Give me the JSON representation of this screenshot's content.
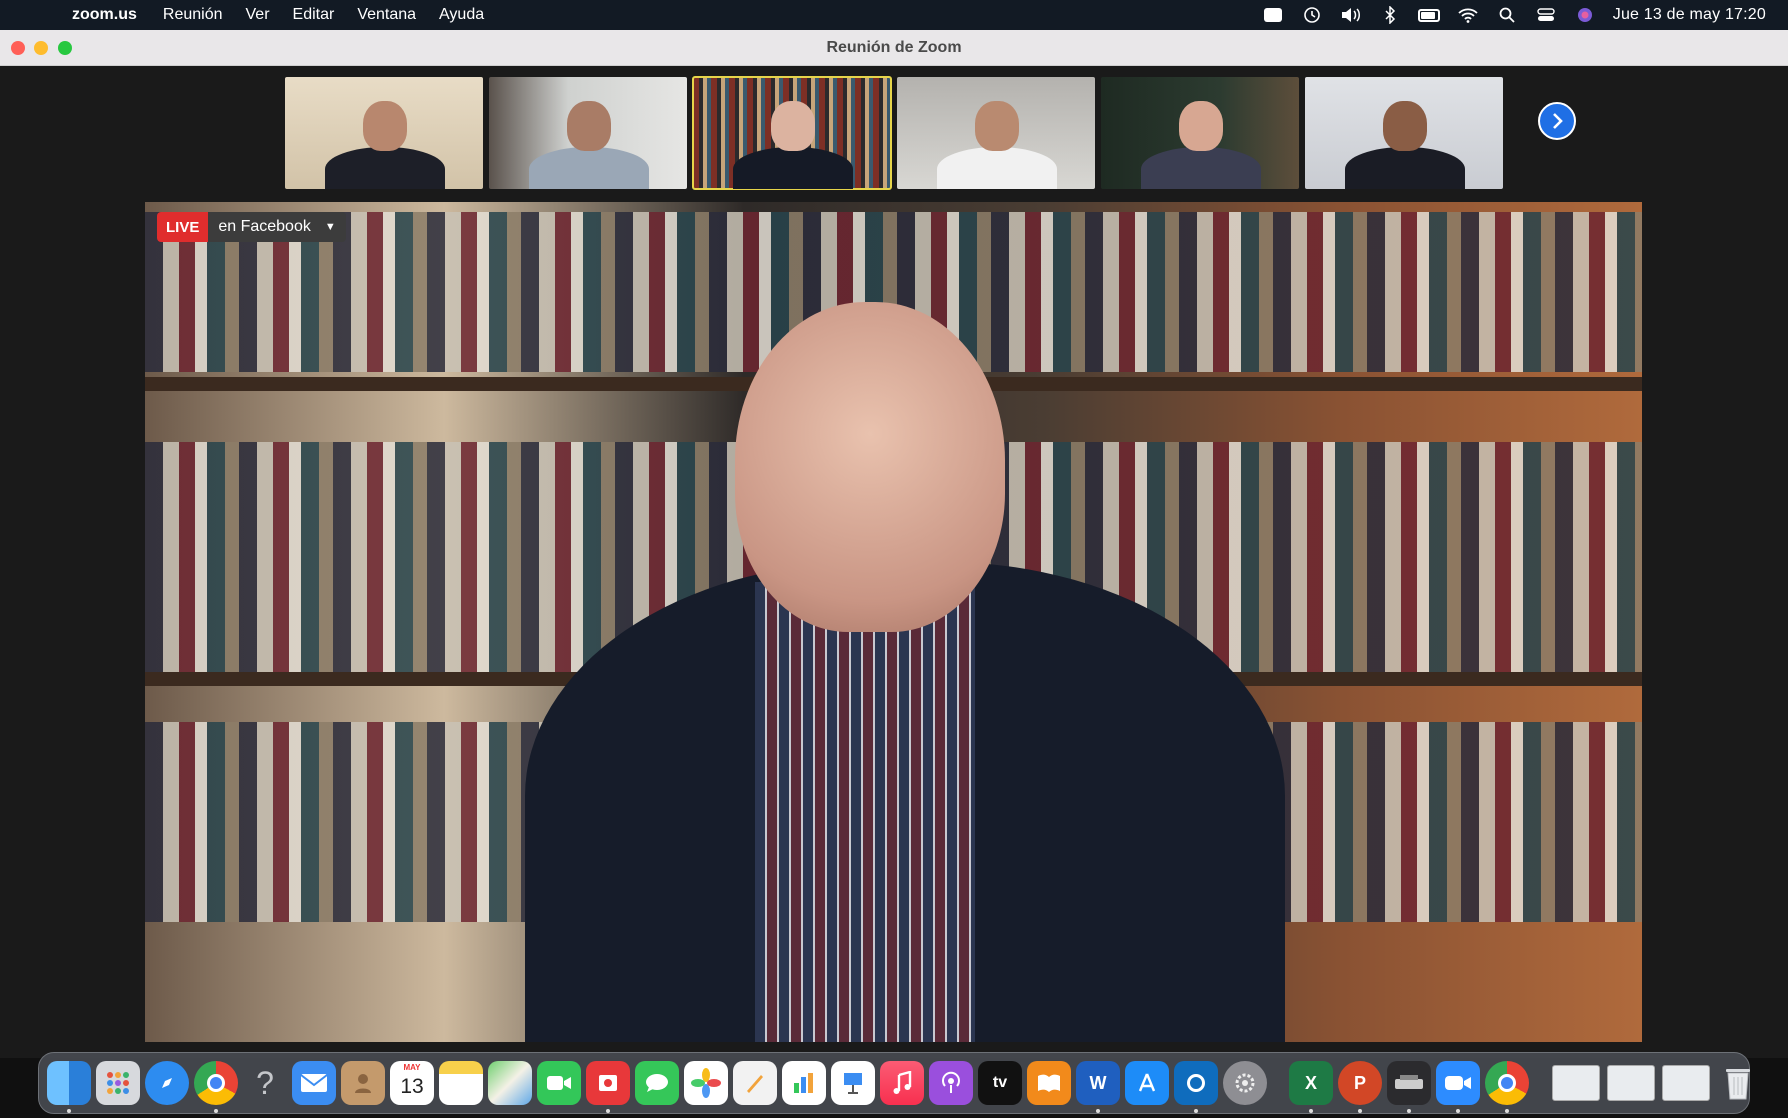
{
  "menubar": {
    "app_name": "zoom.us",
    "items": [
      "Reunión",
      "Ver",
      "Editar",
      "Ventana",
      "Ayuda"
    ],
    "clock": "Jue 13 de may  17:20"
  },
  "window": {
    "title": "Reunión de Zoom"
  },
  "live": {
    "tag": "LIVE",
    "label": "en Facebook"
  },
  "dock": {
    "calendar": {
      "month": "MAY",
      "day": "13"
    },
    "excel_letter": "X",
    "powerpoint_letter": "P",
    "word_letter": "W",
    "tv_label": "tv"
  },
  "colors": {
    "menubar_bg": "#121a24",
    "live_red": "#e02d2d",
    "active_speaker_outline": "#e6d54a",
    "next_button": "#1f6fe5"
  }
}
